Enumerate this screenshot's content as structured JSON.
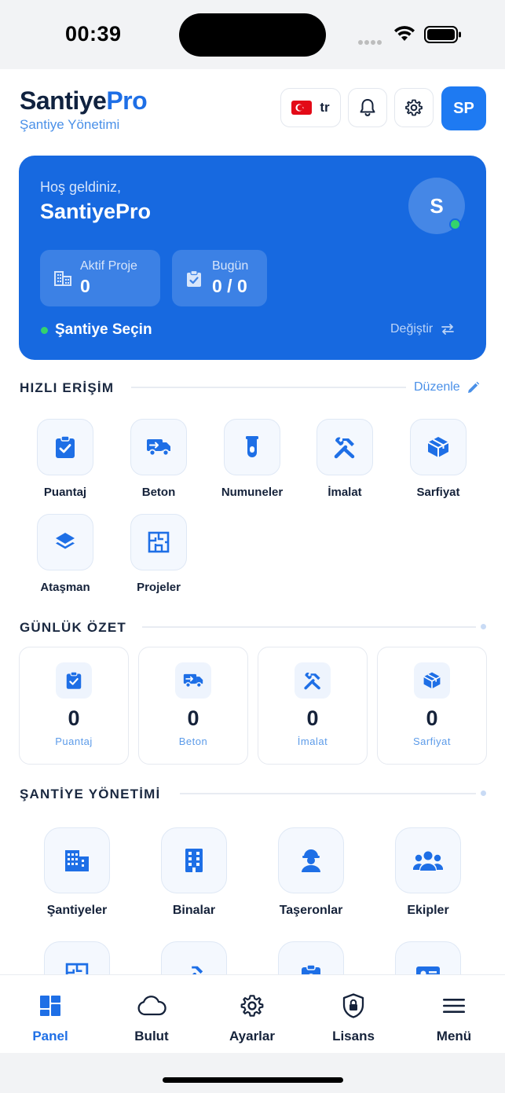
{
  "status_bar": {
    "time": "00:39"
  },
  "header": {
    "brand_part1": "Santiye",
    "brand_part2": "Pro",
    "subtitle": "Şantiye Yönetimi",
    "language_code": "tr",
    "user_initials": "SP"
  },
  "hero": {
    "greeting": "Hoş geldiniz,",
    "name": "SantiyePro",
    "avatar_initial": "S",
    "stats": [
      {
        "label": "Aktif Proje",
        "value": "0",
        "icon": "building-icon"
      },
      {
        "label": "Bugün",
        "value": "0 / 0",
        "icon": "clipboard-check-icon"
      }
    ],
    "site_label": "Şantiye Seçin",
    "change_label": "Değiştir"
  },
  "quick_access": {
    "title": "HIZLI ERİŞİM",
    "edit_label": "Düzenle",
    "items": [
      {
        "label": "Puantaj",
        "icon": "clipboard-check-icon"
      },
      {
        "label": "Beton",
        "icon": "truck-icon"
      },
      {
        "label": "Numuneler",
        "icon": "test-tube-icon"
      },
      {
        "label": "İmalat",
        "icon": "tools-icon"
      },
      {
        "label": "Sarfiyat",
        "icon": "box-icon"
      },
      {
        "label": "Ataşman",
        "icon": "layers-icon"
      },
      {
        "label": "Projeler",
        "icon": "blueprint-icon"
      }
    ]
  },
  "daily_summary": {
    "title": "GÜNLÜK ÖZET",
    "cards": [
      {
        "label": "Puantaj",
        "value": "0",
        "icon": "clipboard-check-icon"
      },
      {
        "label": "Beton",
        "value": "0",
        "icon": "truck-icon"
      },
      {
        "label": "İmalat",
        "value": "0",
        "icon": "tools-icon"
      },
      {
        "label": "Sarfiyat",
        "value": "0",
        "icon": "box-icon"
      }
    ]
  },
  "site_management": {
    "title": "ŞANTİYE YÖNETİMİ",
    "items": [
      {
        "label": "Şantiyeler",
        "icon": "city-icon"
      },
      {
        "label": "Binalar",
        "icon": "building-icon"
      },
      {
        "label": "Taşeronlar",
        "icon": "worker-icon"
      },
      {
        "label": "Ekipler",
        "icon": "team-icon"
      }
    ]
  },
  "tab_bar": {
    "items": [
      {
        "label": "Panel",
        "icon": "dashboard-icon",
        "active": true
      },
      {
        "label": "Bulut",
        "icon": "cloud-icon"
      },
      {
        "label": "Ayarlar",
        "icon": "gear-icon"
      },
      {
        "label": "Lisans",
        "icon": "shield-lock-icon"
      },
      {
        "label": "Menü",
        "icon": "menu-icon"
      }
    ]
  },
  "colors": {
    "accent": "#1e6fe6",
    "hero_bg": "#1769e0",
    "online": "#34d36d"
  }
}
